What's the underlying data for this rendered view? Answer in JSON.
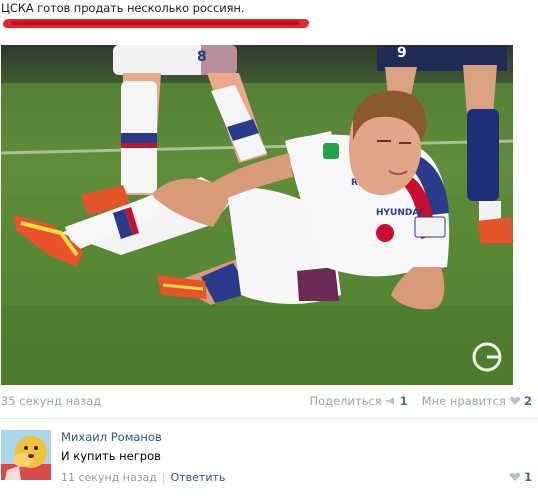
{
  "post": {
    "headline": "ЦСКА готов продать несколько россиян.",
    "timestamp": "35 секунд назад",
    "share_label": "Поделиться",
    "share_count": "1",
    "like_label": "Мне нравится",
    "like_count": "2"
  },
  "comment": {
    "author": "Михаил Романов",
    "text": "И купить негров",
    "timestamp": "11 секунд назад",
    "reply_label": "Ответить",
    "like_count": "1"
  },
  "colors": {
    "accent_link": "#2b587a",
    "redaction": "#e32636",
    "muted": "#9aa3ad"
  }
}
